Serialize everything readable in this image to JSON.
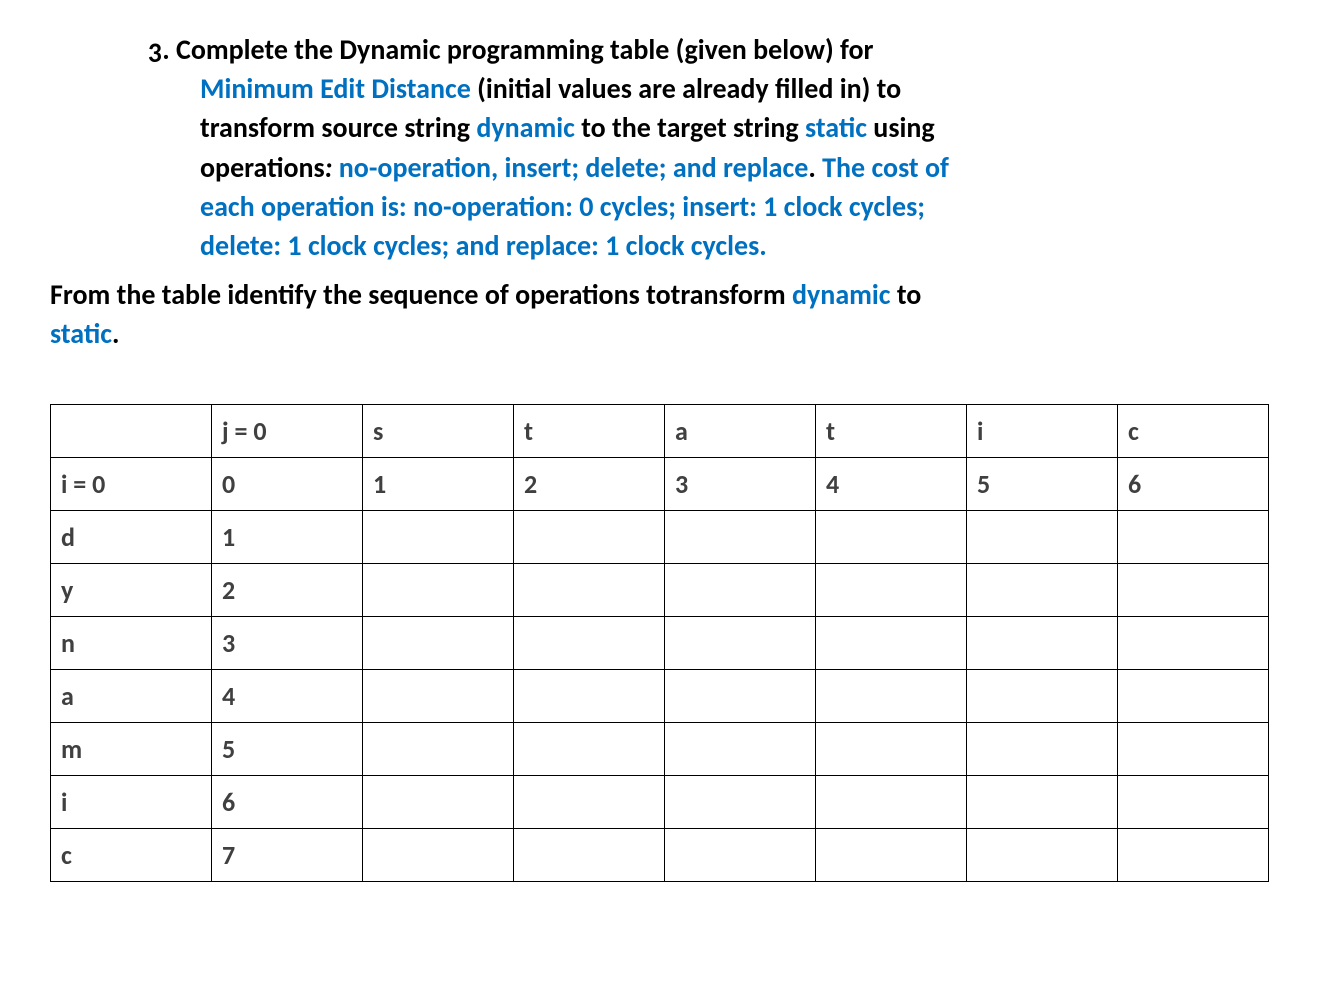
{
  "question": {
    "number": "3.",
    "line1_a": " Complete the Dynamic programming table (given below) for",
    "line2_blue": "Minimum Edit Distance",
    "line2_b": " (initial values are already filled in) to",
    "line3_a": "transform source string ",
    "line3_dynamic": "dynamic",
    "line3_b": " to the target string ",
    "line3_static": "static",
    "line3_c": " using",
    "line4_a": "operations",
    "line4_colon": ": ",
    "line4_ops": "no-operation, insert; delete; and replace",
    "line4_b": ". ",
    "line4_cost": "The cost of",
    "line5_cost": "each operation is: no-operation: 0 cycles; insert: 1 clock cycles;",
    "line6_cost": "delete: 1 clock cycles; and replace: 1 clock cycles."
  },
  "followup": {
    "a": "From the table identify the sequence of operations totransform ",
    "dynamic": "dynamic",
    "b": " to ",
    "static": "static",
    "c": "."
  },
  "table": {
    "col_headers": [
      "",
      "j = 0",
      "s",
      "t",
      "a",
      "t",
      "i",
      "c"
    ],
    "rows": [
      {
        "hdr": "i = 0",
        "cells": [
          "0",
          "1",
          "2",
          "3",
          "4",
          "5",
          "6"
        ]
      },
      {
        "hdr": "d",
        "cells": [
          "1",
          "",
          "",
          "",
          "",
          "",
          ""
        ]
      },
      {
        "hdr": "y",
        "cells": [
          "2",
          "",
          "",
          "",
          "",
          "",
          ""
        ]
      },
      {
        "hdr": "n",
        "cells": [
          "3",
          "",
          "",
          "",
          "",
          "",
          ""
        ]
      },
      {
        "hdr": "a",
        "cells": [
          "4",
          "",
          "",
          "",
          "",
          "",
          ""
        ]
      },
      {
        "hdr": "m",
        "cells": [
          "5",
          "",
          "",
          "",
          "",
          "",
          ""
        ]
      },
      {
        "hdr": "i",
        "cells": [
          "6",
          "",
          "",
          "",
          "",
          "",
          ""
        ]
      },
      {
        "hdr": "c",
        "cells": [
          "7",
          "",
          "",
          "",
          "",
          "",
          ""
        ]
      }
    ]
  }
}
